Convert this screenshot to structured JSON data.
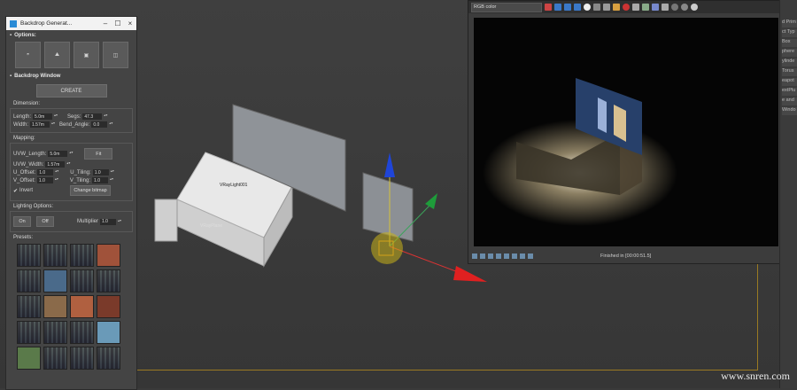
{
  "backdrop_panel": {
    "title": "Backdrop Generat...",
    "options_header": "Options:",
    "backdrop_header": "Backdrop Window",
    "create_label": "CREATE",
    "dimension_label": "Dimension:",
    "length_label": "Length:",
    "length_value": "5.0m",
    "width_label": "Width:",
    "width_value": "1.57m",
    "segs_label": "Segs:",
    "segs_value": "47.3",
    "bend_angle_label": "Bend_Angle:",
    "bend_angle_value": "0.0",
    "mapping_label": "Mapping:",
    "uvw_length_label": "UVW_Length:",
    "uvw_length_value": "5.0m",
    "uvw_width_label": "UVW_Width:",
    "uvw_width_value": "1.57m",
    "fit_label": "Fit",
    "u_offset_label": "U_Offset:",
    "u_offset_value": "1.0",
    "v_offset_label": "V_Offset:",
    "v_offset_value": "1.0",
    "u_tiling_label": "U_Tiling:",
    "u_tiling_value": "1.0",
    "v_tiling_label": "V_Tiling:",
    "v_tiling_value": "1.0",
    "invert_label": "Invert",
    "change_bitmap_label": "Change bitmap",
    "lighting_label": "Lighting Options:",
    "on_label": "On",
    "off_label": "Off",
    "multiplier_label": "Multiplier",
    "multiplier_value": "1.0",
    "presets_label": "Presets:"
  },
  "scene": {
    "label_box": "VRayLight001",
    "label_plane": "VRayPlane"
  },
  "render_window": {
    "channel": "RGB color",
    "status": "Finished in [00:00:51.5]"
  },
  "command_panel": {
    "items": [
      "d Prim",
      "ct Typ",
      "Box",
      "phere",
      "ylinde",
      "Torus",
      "eapot",
      "extPlu",
      "e and",
      "Windo"
    ]
  },
  "watermark": "www.snren.com",
  "colors": {
    "accent": "#2a8bd6",
    "grid": "#9a7a22"
  }
}
